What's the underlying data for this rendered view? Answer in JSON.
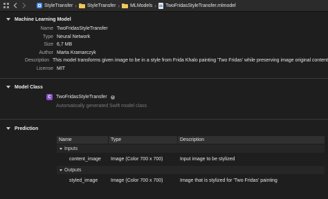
{
  "breadcrumbs": [
    "StyleTransfer",
    "StyleTransfer",
    "MLModels",
    "TwoFridasStyleTransfer.mlmodel"
  ],
  "sections": {
    "model": {
      "title": "Machine Learning Model",
      "rows": [
        {
          "key": "Name",
          "value": "TwoFridasStyleTransfer"
        },
        {
          "key": "Type",
          "value": "Neural Network"
        },
        {
          "key": "Size",
          "value": "6,7 MB"
        },
        {
          "key": "Author",
          "value": "Marta Kramarczyk"
        },
        {
          "key": "Description",
          "value": "This model transforms given image to be in a style from Frida Khalo painting 'Two Fridas' while preserving image original content"
        },
        {
          "key": "License",
          "value": "MIT"
        }
      ]
    },
    "class": {
      "title": "Model Class",
      "badge": "C",
      "name": "TwoFridasStyleTransfer",
      "subtitle": "Automatically generated Swift model class"
    },
    "prediction": {
      "title": "Prediction",
      "headers": [
        "Name",
        "Type",
        "Description"
      ],
      "inputs_label": "Inputs",
      "outputs_label": "Outputs",
      "inputs": [
        {
          "name": "content_image",
          "type": "Image (Color 700 x 700)",
          "description": "Input image to be stylized"
        }
      ],
      "outputs": [
        {
          "name": "styled_image",
          "type": "Image (Color 700 x 700)",
          "description": "Image that is stylized for 'Two Fridas' painting"
        }
      ]
    }
  },
  "icons": {
    "grid": "grid-icon",
    "back": "chevron-left-icon",
    "forward": "chevron-right-icon"
  }
}
